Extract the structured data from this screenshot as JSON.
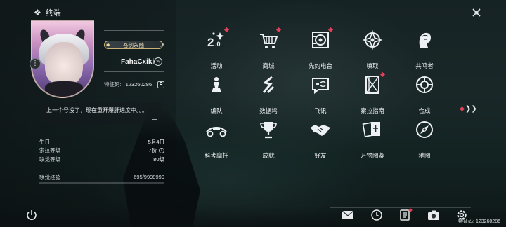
{
  "header": {
    "title": "终端"
  },
  "profile": {
    "title_badge": "吾剑永随",
    "username": "FahaCxiki",
    "uid_label": "特征码:",
    "uid_value": "123260286",
    "signature": "上一个号没了，现在重开爆肝进度中。。。",
    "stats": [
      {
        "label": "生日",
        "value": "5月4日"
      },
      {
        "label": "索拉等级",
        "value": "7阶"
      },
      {
        "label": "联觉等级",
        "value": "80级"
      }
    ],
    "exp_label": "联觉经验",
    "exp_value": "695/9999999",
    "exp_fraction": 0.0
  },
  "grid": [
    {
      "label": "活动",
      "icon": "activity-2-0-icon",
      "badge": true
    },
    {
      "label": "商城",
      "icon": "cart-icon",
      "badge": true
    },
    {
      "label": "先约电台",
      "icon": "radio-record-icon",
      "badge": true
    },
    {
      "label": "唤取",
      "icon": "convene-icon",
      "badge": false
    },
    {
      "label": "共鸣者",
      "icon": "resonator-icon",
      "badge": false
    },
    {
      "label": "编队",
      "icon": "team-chess-icon",
      "badge": false
    },
    {
      "label": "数据坞",
      "icon": "data-dock-icon",
      "badge": false
    },
    {
      "label": "飞讯",
      "icon": "message-icon",
      "badge": false
    },
    {
      "label": "索拉指南",
      "icon": "guidebook-icon",
      "badge": true
    },
    {
      "label": "合成",
      "icon": "synthesis-icon",
      "badge": false
    },
    {
      "label": "科考摩托",
      "icon": "motorcycle-icon",
      "badge": false
    },
    {
      "label": "成就",
      "icon": "trophy-icon",
      "badge": false
    },
    {
      "label": "好友",
      "icon": "handshake-icon",
      "badge": false
    },
    {
      "label": "万物图鉴",
      "icon": "cards-icon",
      "badge": false
    },
    {
      "label": "地图",
      "icon": "compass-icon",
      "badge": false
    }
  ],
  "footer": {
    "uid_text": "特征码: 123260286"
  },
  "colors": {
    "badge": "#e0425a",
    "accent": "#c8b27a"
  }
}
